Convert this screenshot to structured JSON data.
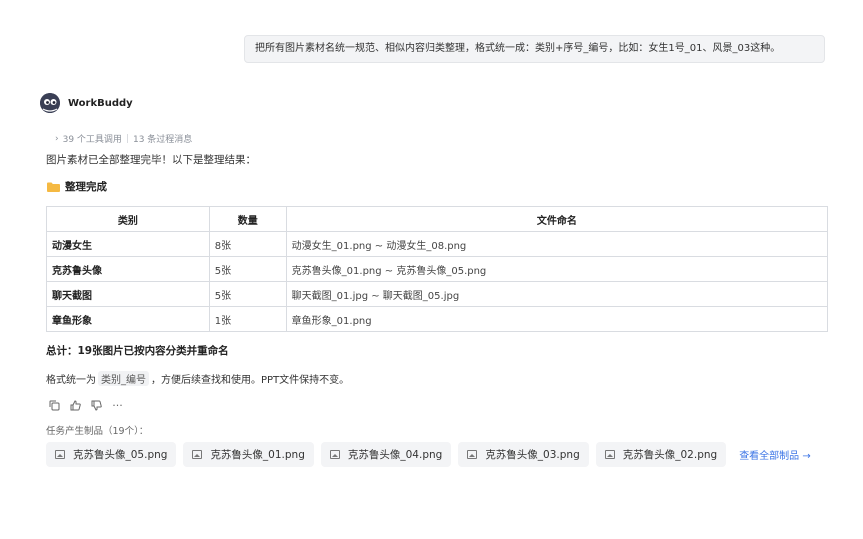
{
  "user_message": "把所有图片素材名统一规范、相似内容归类整理，格式统一成：类别+序号_编号，比如：女生1号_01、风景_03这种。",
  "assistant": {
    "name": "WorkBuddy",
    "tool_calls": "39 个工具调用",
    "process_messages": "13 条过程消息",
    "intro": "图片素材已全部整理完毕！以下是整理结果：",
    "section_title": "整理完成"
  },
  "table": {
    "headers": [
      "类别",
      "数量",
      "文件命名"
    ],
    "rows": [
      {
        "category": "动漫女生",
        "count": "8张",
        "names": "动漫女生_01.png ~ 动漫女生_08.png"
      },
      {
        "category": "克苏鲁头像",
        "count": "5张",
        "names": "克苏鲁头像_01.png ~ 克苏鲁头像_05.png"
      },
      {
        "category": "聊天截图",
        "count": "5张",
        "names": "聊天截图_01.jpg ~ 聊天截图_05.jpg"
      },
      {
        "category": "章鱼形象",
        "count": "1张",
        "names": "章鱼形象_01.png"
      }
    ]
  },
  "summary": "总计：19张图片已按内容分类并重命名",
  "format_note": {
    "prefix": "格式统一为",
    "code": "类别_编号",
    "suffix": "，方便后续查找和使用。PPT文件保持不变。"
  },
  "actions": {
    "copy_icon": "copy-icon",
    "like_icon": "thumbs-up-icon",
    "dislike_icon": "thumbs-down-icon",
    "more_icon": "more-icon",
    "more_glyph": "···"
  },
  "artifacts": {
    "label": "任务产生制品（19个）：",
    "items": [
      "克苏鲁头像_05.png",
      "克苏鲁头像_01.png",
      "克苏鲁头像_04.png",
      "克苏鲁头像_03.png",
      "克苏鲁头像_02.png"
    ],
    "view_all": "查看全部制品 →"
  },
  "colors": {
    "link": "#3b74e6",
    "folder": "#f5b942"
  }
}
